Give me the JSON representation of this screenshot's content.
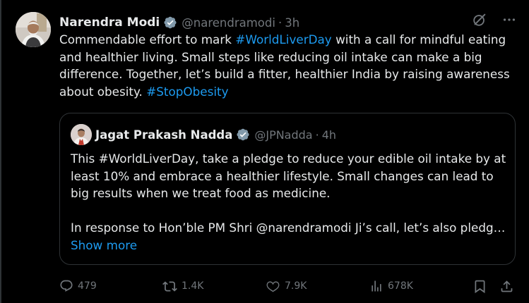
{
  "post": {
    "author": {
      "name": "Narendra Modi",
      "handle": "@narendramodi",
      "time": "3h",
      "separator": "·"
    },
    "text": {
      "segment_1": "Commendable effort to mark ",
      "hashtag_1": "#WorldLiverDay",
      "segment_2": " with a call for mindful eating and healthier living. Small steps like reducing oil intake can make a big difference.  Together, let’s build a fitter, healthier India by raising awareness about obesity. ",
      "hashtag_2": "#StopObesity"
    },
    "quote": {
      "author": {
        "name": "Jagat Prakash Nadda",
        "handle": "@JPNadda",
        "time": "4h",
        "separator": "·"
      },
      "paragraph_1": "This #WorldLiverDay, take a pledge to reduce your edible oil intake by at least 10% and embrace a healthier lifestyle. Small changes can lead to big results when we treat food as medicine.",
      "paragraph_2": "In response to Hon’ble PM Shri @narendramodi Ji’s call, let’s also pledg…",
      "show_more": "Show more"
    },
    "actions": {
      "replies": "479",
      "reposts": "1.4K",
      "likes": "7.9K",
      "views": "678K"
    }
  },
  "colors": {
    "background": "#000000",
    "text_primary": "#e7e9ea",
    "text_secondary": "#71767b",
    "accent": "#1d9bf0",
    "border": "#2f3336"
  }
}
